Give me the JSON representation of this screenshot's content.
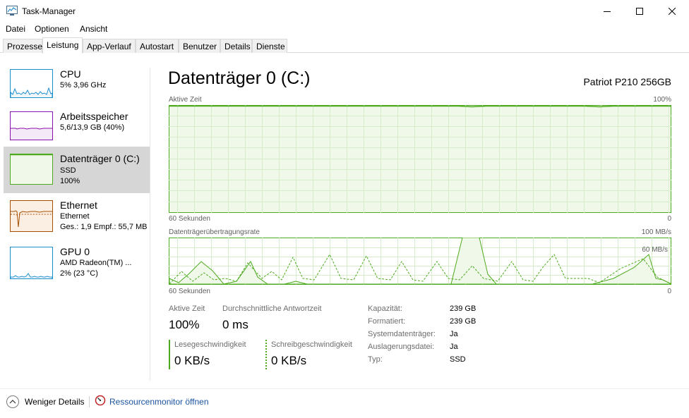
{
  "window": {
    "title": "Task-Manager"
  },
  "menu": [
    {
      "label": "Datei"
    },
    {
      "label": "Optionen"
    },
    {
      "label": "Ansicht"
    }
  ],
  "tabs": [
    {
      "label": "Prozesse"
    },
    {
      "label": "Leistung"
    },
    {
      "label": "App-Verlauf"
    },
    {
      "label": "Autostart"
    },
    {
      "label": "Benutzer"
    },
    {
      "label": "Details"
    },
    {
      "label": "Dienste"
    }
  ],
  "sidebar": {
    "cpu": {
      "title": "CPU",
      "line1": "5%  3,96 GHz"
    },
    "memory": {
      "title": "Arbeitsspeicher",
      "line1": "5,6/13,9 GB (40%)"
    },
    "disk": {
      "title": "Datenträger 0 (C:)",
      "line1": "SSD",
      "line2": "100%"
    },
    "ethernet": {
      "title": "Ethernet",
      "line1": "Ethernet",
      "line2": "Ges.: 1,9  Empf.: 55,7 MB"
    },
    "gpu": {
      "title": "GPU 0",
      "line1": "AMD Radeon(TM) ...",
      "line2": "2% (23 °C)"
    }
  },
  "main": {
    "title": "Datenträger 0 (C:)",
    "model": "Patriot P210 256GB",
    "graph1": {
      "label": "Aktive Zeit",
      "max": "100%",
      "time": "60 Sekunden",
      "min": "0"
    },
    "graph2": {
      "label": "Datenträgerübertragungsrate",
      "max": "100 MB/s",
      "inner": "60 MB/s",
      "time": "60 Sekunden",
      "min": "0"
    }
  },
  "stats": {
    "active_time": {
      "label": "Aktive Zeit",
      "value": "100%"
    },
    "response": {
      "label": "Durchschnittliche Antwortzeit",
      "value": "0 ms"
    },
    "read": {
      "label": "Lesegeschwindigkeit",
      "value": "0 KB/s"
    },
    "write": {
      "label": "Schreibgeschwindigkeit",
      "value": "0 KB/s"
    }
  },
  "properties": [
    {
      "label": "Kapazität:",
      "value": "239 GB"
    },
    {
      "label": "Formatiert:",
      "value": "239 GB"
    },
    {
      "label": "Systemdatenträger:",
      "value": "Ja"
    },
    {
      "label": "Auslagerungsdatei:",
      "value": "Ja"
    },
    {
      "label": "Typ:",
      "value": "SSD"
    }
  ],
  "footer": {
    "fewer_details": "Weniger Details",
    "resource_monitor": "Ressourcenmonitor öffnen"
  },
  "icons": {
    "app": "task-manager-icon",
    "minimize": "minimize-icon",
    "maximize": "maximize-icon",
    "close": "close-icon",
    "collapse": "chevron-up-icon",
    "resmon": "resource-monitor-icon"
  },
  "colors": {
    "disk_line": "#4daa1e",
    "disk_fill": "#eff8e9",
    "grid": "#d7ecc9",
    "cpu": "#1c8fd0",
    "memory": "#8b12ae",
    "ethernet": "#a74f01",
    "link": "#1c53a0"
  }
}
